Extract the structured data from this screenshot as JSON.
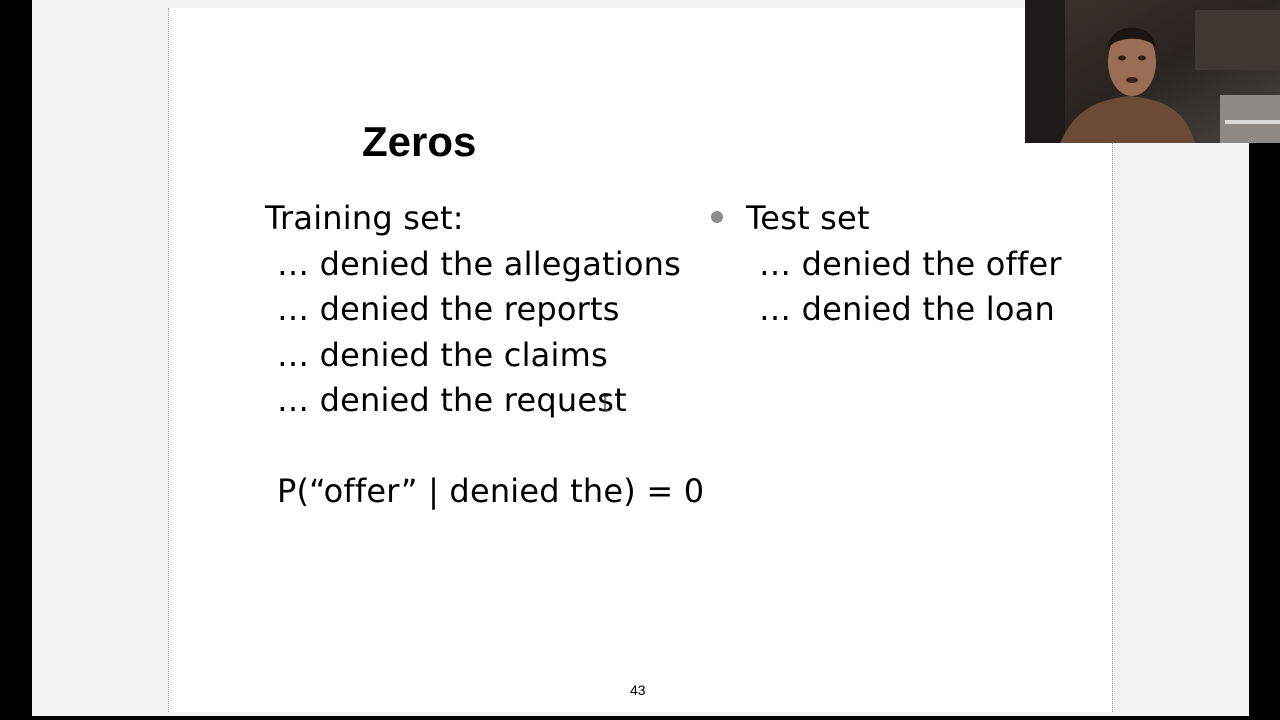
{
  "slide": {
    "title": "Zeros",
    "training": {
      "heading": "Training set:",
      "items": [
        "… denied the allegations",
        "… denied the reports",
        "… denied the claims",
        "… denied the request"
      ]
    },
    "test": {
      "heading": "Test set",
      "items": [
        "… denied the offer",
        "… denied the loan"
      ]
    },
    "formula": "P(“offer” | denied the) = 0",
    "page_number": "43"
  },
  "webcam": {
    "icon": "presenter-video-icon"
  },
  "colors": {
    "background": "#000000",
    "stage": "#f3f3f3",
    "slide": "#ffffff",
    "bullet": "#8c8c8c",
    "text": "#000000"
  }
}
